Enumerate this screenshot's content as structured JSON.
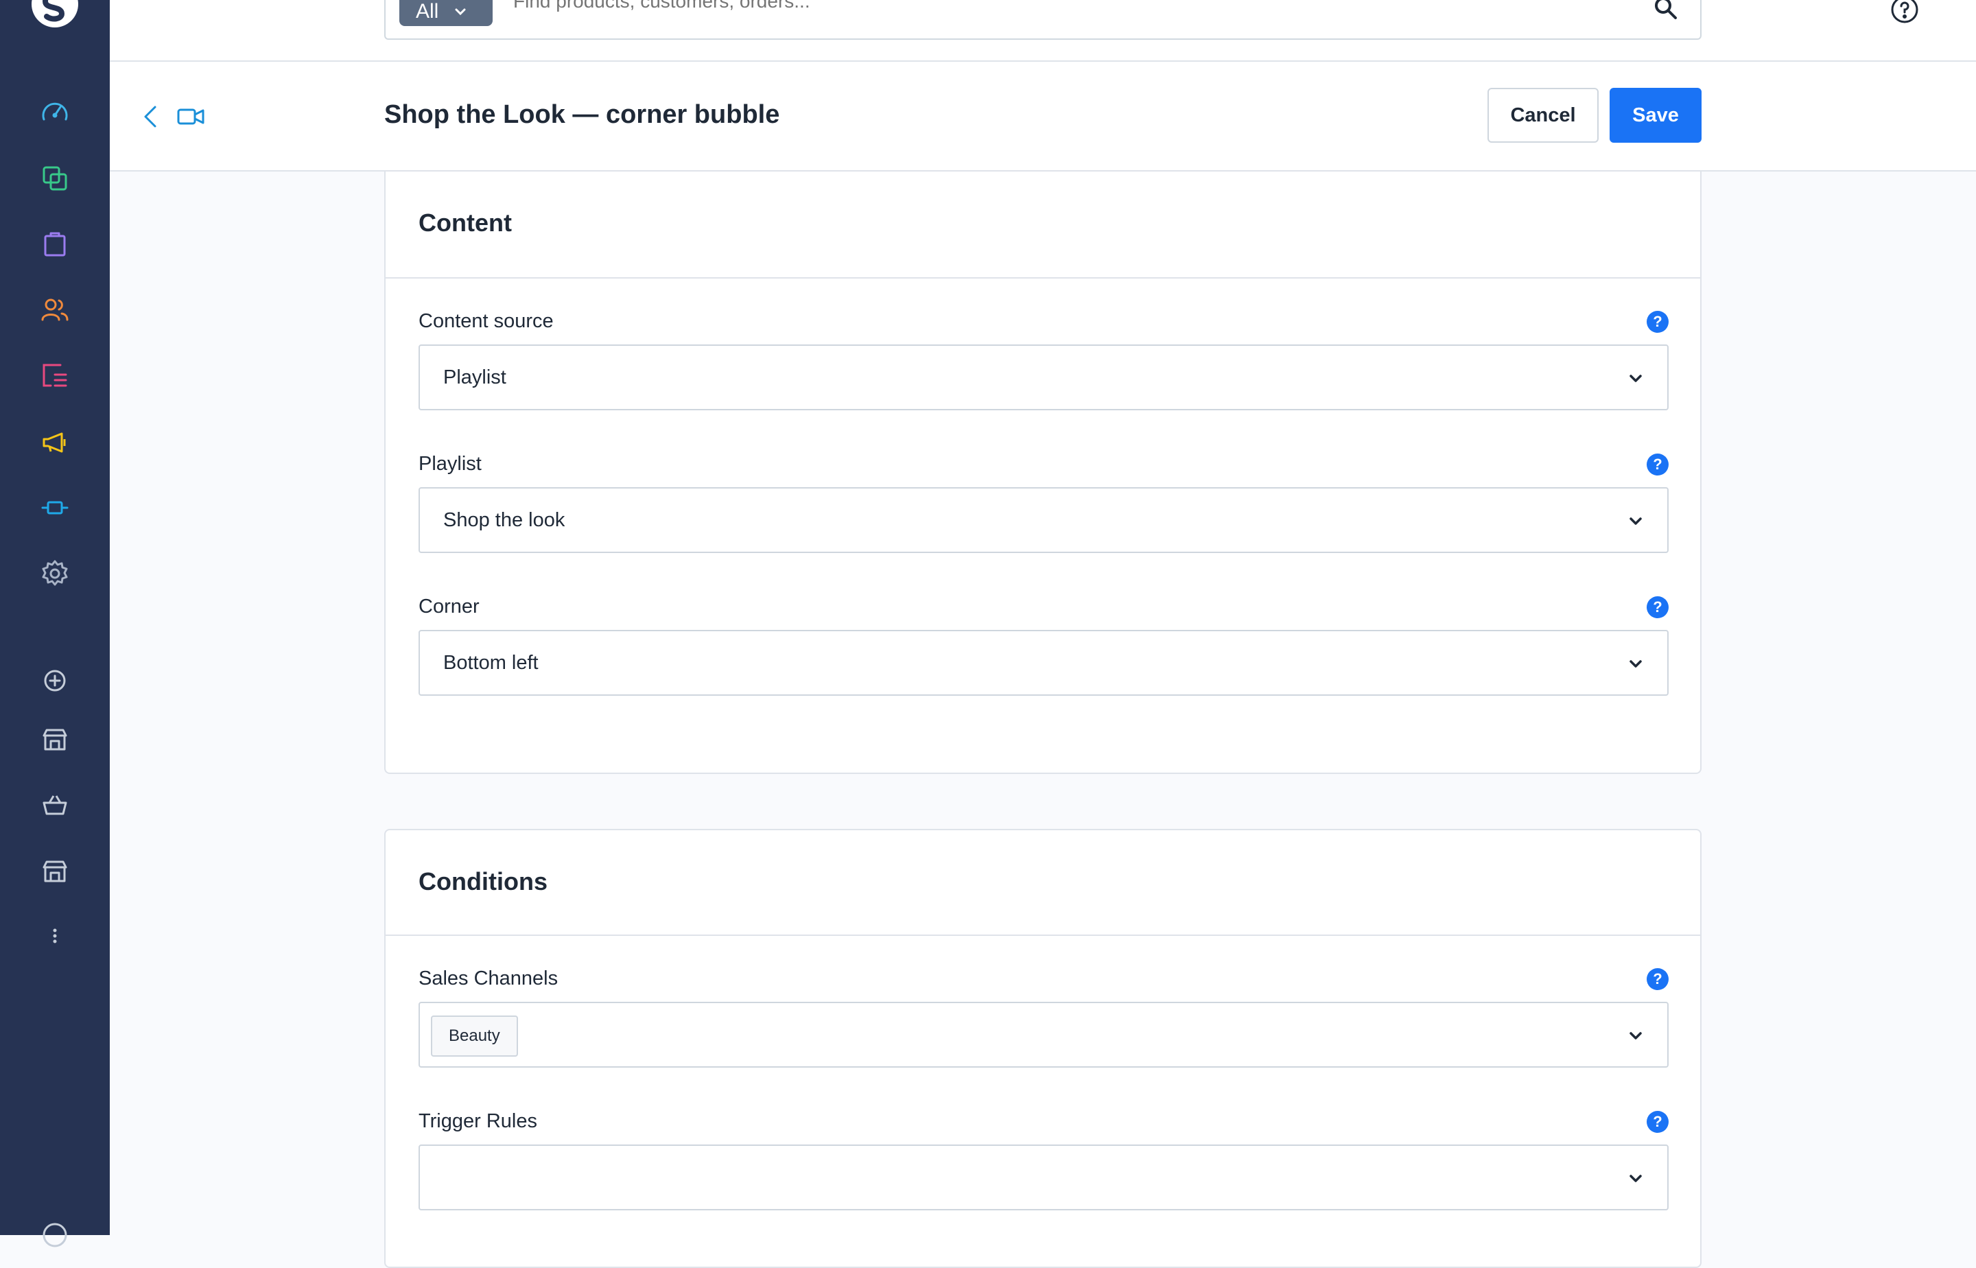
{
  "colors": {
    "sidebar_bg": "#263353",
    "primary": "#1a73f5",
    "page_bg": "#f9fafd"
  },
  "sidebar": {
    "icons": [
      "logo-icon",
      "dashboard-icon",
      "catalogue-icon",
      "orders-icon",
      "customers-icon",
      "content-icon",
      "marketing-icon",
      "extensions-icon",
      "settings-icon",
      "add-sales-channel-icon",
      "storefront-icon",
      "basket-icon",
      "storefront-icon",
      "more-icon",
      "help-icon"
    ]
  },
  "search": {
    "filter_label": "All",
    "placeholder": "Find products, customers, orders..."
  },
  "header": {
    "title": "Shop the Look — corner bubble",
    "cancel_label": "Cancel",
    "save_label": "Save"
  },
  "content_card": {
    "title": "Content",
    "fields": [
      {
        "label": "Content source",
        "value": "Playlist",
        "help": "?"
      },
      {
        "label": "Playlist",
        "value": "Shop the look",
        "help": "?"
      },
      {
        "label": "Corner",
        "value": "Bottom left",
        "help": "?"
      }
    ]
  },
  "conditions_card": {
    "title": "Conditions",
    "sales_channels": {
      "label": "Sales Channels",
      "help": "?",
      "tags": [
        "Beauty"
      ]
    },
    "trigger_rules": {
      "label": "Trigger Rules",
      "help": "?",
      "value": ""
    }
  }
}
